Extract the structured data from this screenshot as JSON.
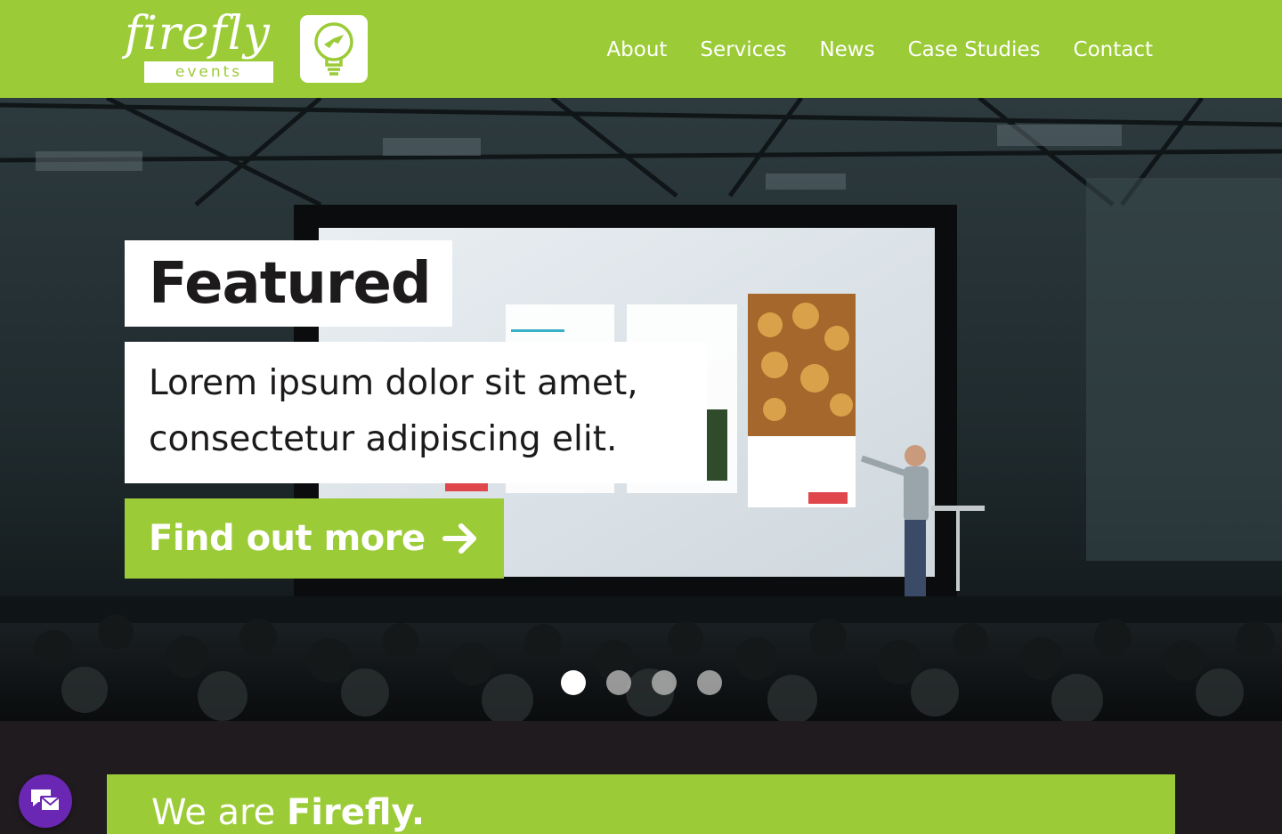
{
  "brand": {
    "wordmark": "firefly",
    "tagline": "events"
  },
  "nav": {
    "items": [
      {
        "label": "About"
      },
      {
        "label": "Services"
      },
      {
        "label": "News"
      },
      {
        "label": "Case Studies"
      },
      {
        "label": "Contact"
      }
    ]
  },
  "hero": {
    "title": "Featured",
    "lead": "Lorem ipsum dolor sit amet, consectetur adipiscing elit.",
    "cta_label": "Find out more",
    "cta_icon": "arrow-right-icon",
    "slides_total": 4,
    "active_slide": 1,
    "image": "presenter-on-stage-photo"
  },
  "intro": {
    "heading_prefix": "We are",
    "heading_brand": "Firefly."
  },
  "chat_widget": {
    "icon": "messages-icon"
  },
  "colors": {
    "brand_green": "#9bcb37",
    "dark": "#201b1f",
    "chat_purple": "#6a27b3",
    "white": "#ffffff"
  }
}
